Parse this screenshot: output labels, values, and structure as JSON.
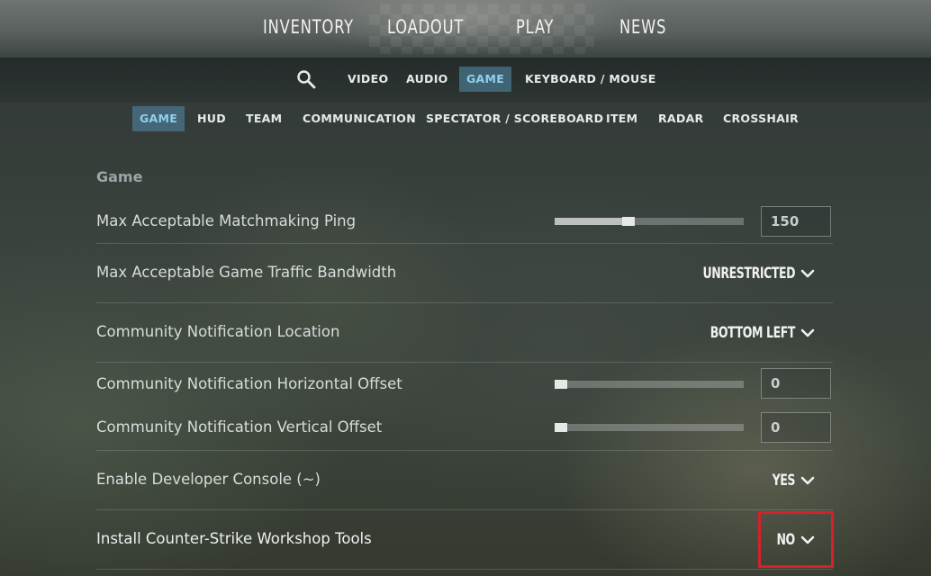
{
  "top_nav": {
    "inventory": "INVENTORY",
    "loadout": "LOADOUT",
    "play": "PLAY",
    "news": "NEWS"
  },
  "settings_tabs": {
    "search_icon": "search-icon",
    "video": "VIDEO",
    "audio": "AUDIO",
    "game": "GAME",
    "keyboard_mouse": "KEYBOARD / MOUSE",
    "active": "GAME"
  },
  "sub_tabs": {
    "game": "GAME",
    "hud": "HUD",
    "team": "TEAM",
    "communication": "COMMUNICATION",
    "spectator": "SPECTATOR / SCOREBOARD",
    "item": "ITEM",
    "radar": "RADAR",
    "crosshair": "CROSSHAIR",
    "active": "GAME"
  },
  "section": {
    "title": "Game"
  },
  "settings": {
    "ping": {
      "label": "Max Acceptable Matchmaking Ping",
      "value": "150",
      "slider_fraction": 0.39
    },
    "bandwidth": {
      "label": "Max Acceptable Game Traffic Bandwidth",
      "value": "UNRESTRICTED"
    },
    "notif_location": {
      "label": "Community Notification Location",
      "value": "BOTTOM LEFT"
    },
    "notif_h_offset": {
      "label": "Community Notification Horizontal Offset",
      "value": "0",
      "slider_fraction": 0.0
    },
    "notif_v_offset": {
      "label": "Community Notification Vertical Offset",
      "value": "0",
      "slider_fraction": 0.0
    },
    "dev_console": {
      "label": "Enable Developer Console (~)",
      "value": "YES"
    },
    "workshop_tools": {
      "label": "Install Counter-Strike Workshop Tools",
      "value": "NO"
    }
  },
  "colors": {
    "active_tab_bg": "#4a768c",
    "active_tab_text": "#8fd0ee",
    "highlight_border": "#d8202a"
  }
}
